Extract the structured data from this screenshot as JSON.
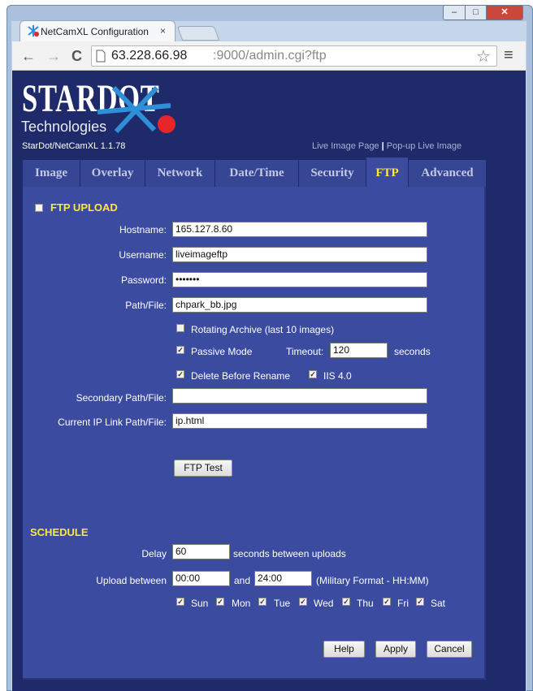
{
  "browser": {
    "tab_title": "NetCamXL Configuration",
    "tab_close": "×",
    "url_host": "63.228.66.98",
    "url_path": ":9000/admin.cgi?ftp",
    "back_icon": "←",
    "forward_icon": "→",
    "reload_icon": "C",
    "star_icon": "☆",
    "menu_icon": "≡",
    "min_icon": "–",
    "max_icon": "□",
    "close_icon": "✕"
  },
  "header": {
    "brand": "STARDOT",
    "brand_sub": "Technologies",
    "version": "StarDot/NetCamXL 1.1.78",
    "links": {
      "live": "Live Image Page",
      "sep": "|",
      "popup": "Pop-up Live Image"
    }
  },
  "tabs": [
    {
      "label": "Image"
    },
    {
      "label": "Overlay"
    },
    {
      "label": "Network"
    },
    {
      "label": "Date/Time"
    },
    {
      "label": "Security"
    },
    {
      "label": "FTP"
    },
    {
      "label": "Advanced"
    }
  ],
  "ftp": {
    "title": "FTP UPLOAD",
    "enabled": false,
    "hostname_label": "Hostname:",
    "hostname": "165.127.8.60",
    "username_label": "Username:",
    "username": "liveimageftp",
    "password_label": "Password:",
    "password": "•••••••",
    "path_label": "Path/File:",
    "path": "chpark_bb.jpg",
    "rotating_label": "Rotating Archive (last 10 images)",
    "rotating": false,
    "passive_label": "Passive Mode",
    "passive": true,
    "timeout_label": "Timeout:",
    "timeout": "120",
    "seconds_label": "seconds",
    "delete_label": "Delete Before Rename",
    "delete": true,
    "iis_label": "IIS 4.0",
    "iis": true,
    "secondary_label": "Secondary Path/File:",
    "secondary": "",
    "iplink_label": "Current IP Link Path/File:",
    "iplink": "ip.html",
    "test_button": "FTP Test"
  },
  "schedule": {
    "title": "SCHEDULE",
    "delay_label": "Delay",
    "delay": "60",
    "delay_suffix": "seconds between uploads",
    "between_label": "Upload between",
    "start": "00:00",
    "and_label": "and",
    "end": "24:00",
    "format_note": "(Military Format - HH:MM)",
    "days": [
      {
        "label": "Sun",
        "checked": true
      },
      {
        "label": "Mon",
        "checked": true
      },
      {
        "label": "Tue",
        "checked": true
      },
      {
        "label": "Wed",
        "checked": true
      },
      {
        "label": "Thu",
        "checked": true
      },
      {
        "label": "Fri",
        "checked": true
      },
      {
        "label": "Sat",
        "checked": true
      }
    ]
  },
  "actions": {
    "help": "Help",
    "apply": "Apply",
    "cancel": "Cancel"
  },
  "colors": {
    "page_bg": "#1f2a6a",
    "panel_bg": "#3b4ba0",
    "accent": "#ffe83a",
    "logo_dot": "#e8262a",
    "logo_star": "#2f8fd6"
  }
}
